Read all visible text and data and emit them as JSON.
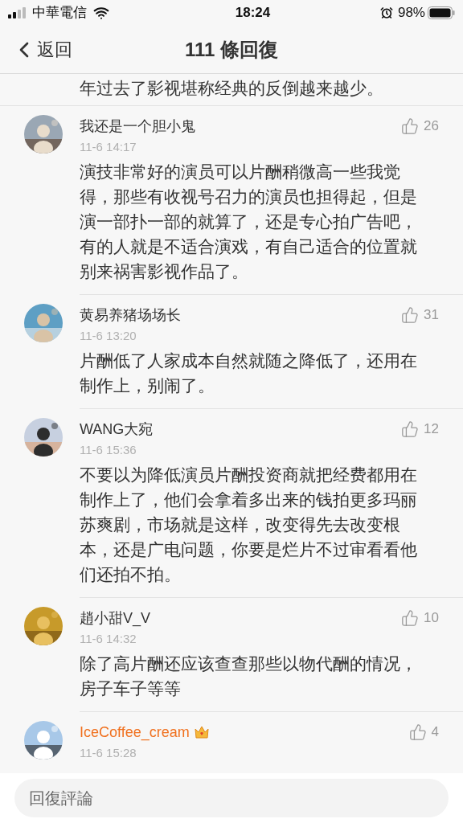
{
  "status_bar": {
    "carrier": "中華電信",
    "time": "18:24",
    "battery": "98%"
  },
  "nav": {
    "back": "返回",
    "title": "111 條回復"
  },
  "partial_text": "年过去了影视堪称经典的反倒越来越少。",
  "comments": [
    {
      "name": "我还是一个胆小鬼",
      "time": "11-6 14:17",
      "likes": "26",
      "vip": false,
      "text": "演技非常好的演员可以片酬稍微高一些我觉得，那些有收视号召力的演员也担得起，但是演一部扑一部的就算了，还是专心拍广告吧，有的人就是不适合演戏，有自己适合的位置就别来祸害影视作品了。"
    },
    {
      "name": "黄易养猪场场长",
      "time": "11-6 13:20",
      "likes": "31",
      "vip": false,
      "text": "片酬低了人家成本自然就随之降低了，还用在制作上，别闹了。"
    },
    {
      "name": "WANG大宛",
      "time": "11-6 15:36",
      "likes": "12",
      "vip": false,
      "text": "不要以为降低演员片酬投资商就把经费都用在制作上了，他们会拿着多出来的钱拍更多玛丽苏爽剧，市场就是这样，改变得先去改变根本，还是广电问题，你要是烂片不过审看看他们还拍不拍。"
    },
    {
      "name": "趙小甜V_V",
      "time": "11-6 14:32",
      "likes": "10",
      "vip": false,
      "text": "除了高片酬还应该查查那些以物代酬的情况，房子车子等等"
    },
    {
      "name": "IceCoffee_cream",
      "time": "11-6 15:28",
      "likes": "4",
      "vip": true
    }
  ],
  "reply_field": {
    "placeholder": "回復評論"
  }
}
